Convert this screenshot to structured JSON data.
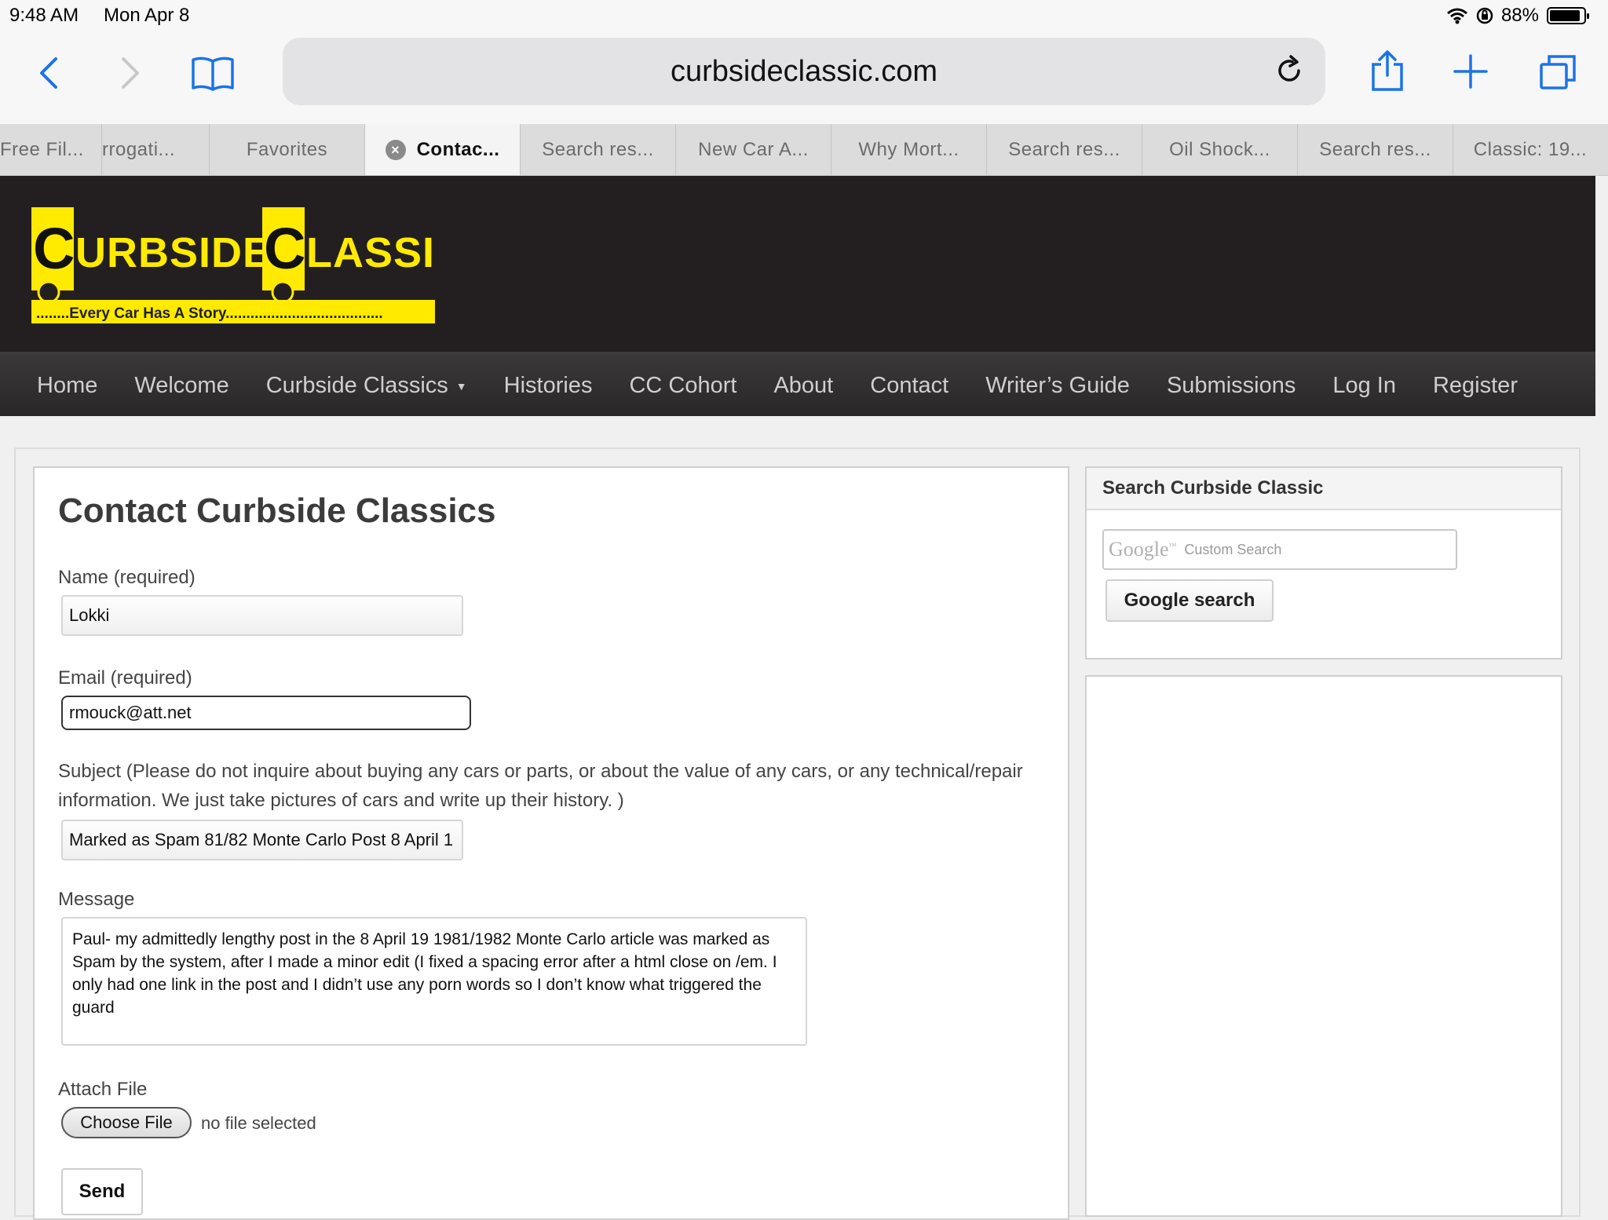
{
  "status": {
    "time": "9:48 AM",
    "date": "Mon Apr 8",
    "battery": "88%"
  },
  "browser": {
    "url": "curbsideclassic.com",
    "tabs": [
      {
        "label": "Free Fil...",
        "active": false
      },
      {
        "label": "rrogati...",
        "active": false
      },
      {
        "label": "Favorites",
        "active": false
      },
      {
        "label": "Contac...",
        "active": true
      },
      {
        "label": "Search res...",
        "active": false
      },
      {
        "label": "New Car A...",
        "active": false
      },
      {
        "label": "Why Mort...",
        "active": false
      },
      {
        "label": "Search res...",
        "active": false
      },
      {
        "label": "Oil Shock...",
        "active": false
      },
      {
        "label": "Search res...",
        "active": false
      },
      {
        "label": "Classic: 19...",
        "active": false
      }
    ]
  },
  "site": {
    "logo": {
      "word1": "URBSIDE",
      "word2": "LASSIC",
      "initial1": "C",
      "initial2": "C",
      "tagline": "........Every Car Has A Story......................................"
    },
    "nav": [
      "Home",
      "Welcome",
      "Curbside Classics",
      "Histories",
      "CC Cohort",
      "About",
      "Contact",
      "Writer’s Guide",
      "Submissions",
      "Log In",
      "Register"
    ]
  },
  "form": {
    "title": "Contact Curbside Classics",
    "name_label": "Name (required)",
    "name_value": "Lokki",
    "email_label": "Email (required)",
    "email_value": "rmouck@att.net",
    "subject_label": "Subject (Please do not inquire about buying any cars or parts, or about the value of any cars, or any technical/repair information. We just take pictures of cars and write up their history. )",
    "subject_value": "Marked as Spam 81/82 Monte Carlo Post 8 April 1",
    "message_label": "Message",
    "message_value": "Paul- my admittedly lengthy post in the 8 April 19 1981/1982 Monte Carlo article was marked as Spam by the system, after I made a minor edit (I fixed a spacing error after a html close on /em. I only had one link in the post and I didn’t use any porn words so I don’t know what triggered the guard",
    "attach_label": "Attach File",
    "choose_file": "Choose File",
    "no_file": "no file selected",
    "send": "Send"
  },
  "sidebar": {
    "title": "Search Curbside Classic",
    "google_logo": "Google",
    "search_placeholder": "Custom Search",
    "search_button": "Google search"
  },
  "colors": {
    "logo_yellow": "#ffea00",
    "header_bg": "#231f20",
    "ios_blue": "#1a73e8"
  }
}
